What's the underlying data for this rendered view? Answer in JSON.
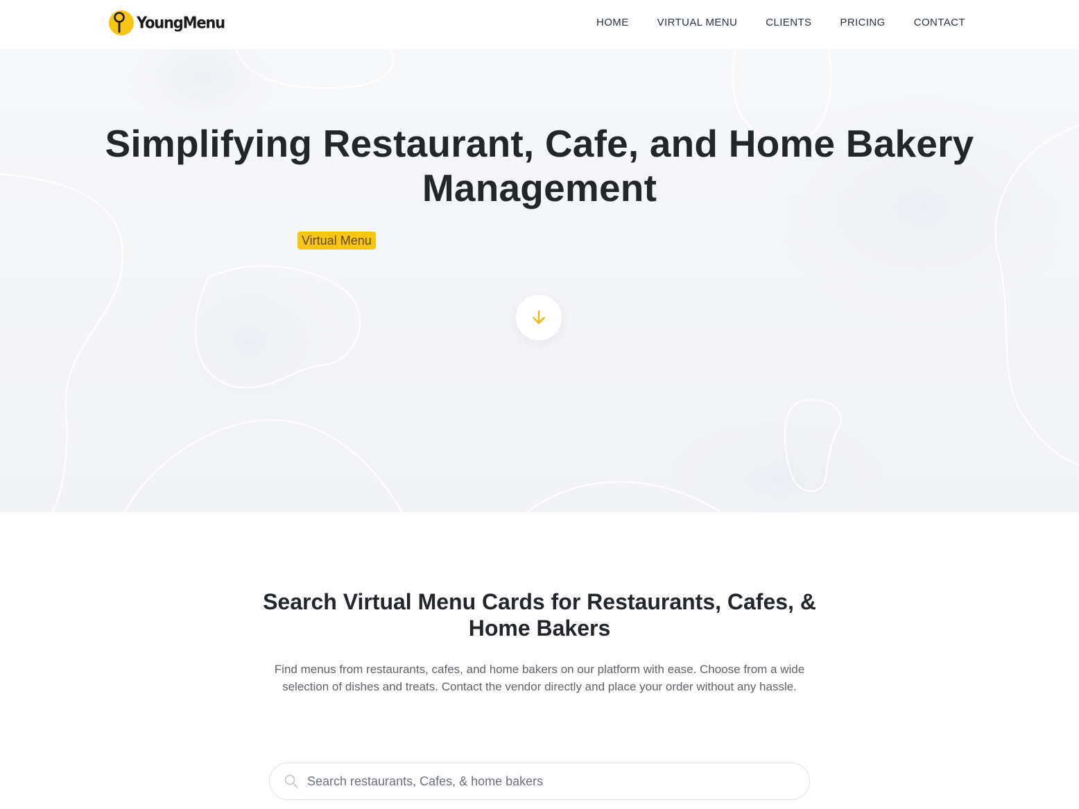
{
  "brand": {
    "name": "YoungMenu",
    "accent_color": "#f9c513",
    "logo_icon": "fork-pin-icon"
  },
  "nav": {
    "items": [
      {
        "label": "HOME"
      },
      {
        "label": "VIRTUAL MENU"
      },
      {
        "label": "CLIENTS"
      },
      {
        "label": "PRICING"
      },
      {
        "label": "CONTACT"
      }
    ]
  },
  "hero": {
    "title_line1": "Simplifying Restaurant, Cafe, and Home Bakery",
    "title_line2": "Management",
    "tag": "Virtual Menu",
    "scroll_icon": "arrow-down-icon"
  },
  "search_section": {
    "title_line1": "Search Virtual Menu Cards for Restaurants, Cafes, &",
    "title_line2": "Home Bakers",
    "description": "Find menus from restaurants, cafes, and home bakers on our platform with ease. Choose from a wide selection of dishes and treats. Contact the vendor directly and place your order without any hassle.",
    "search_placeholder": "Search restaurants, Cafes, & home bakers",
    "search_value": "",
    "search_icon": "search-icon"
  }
}
